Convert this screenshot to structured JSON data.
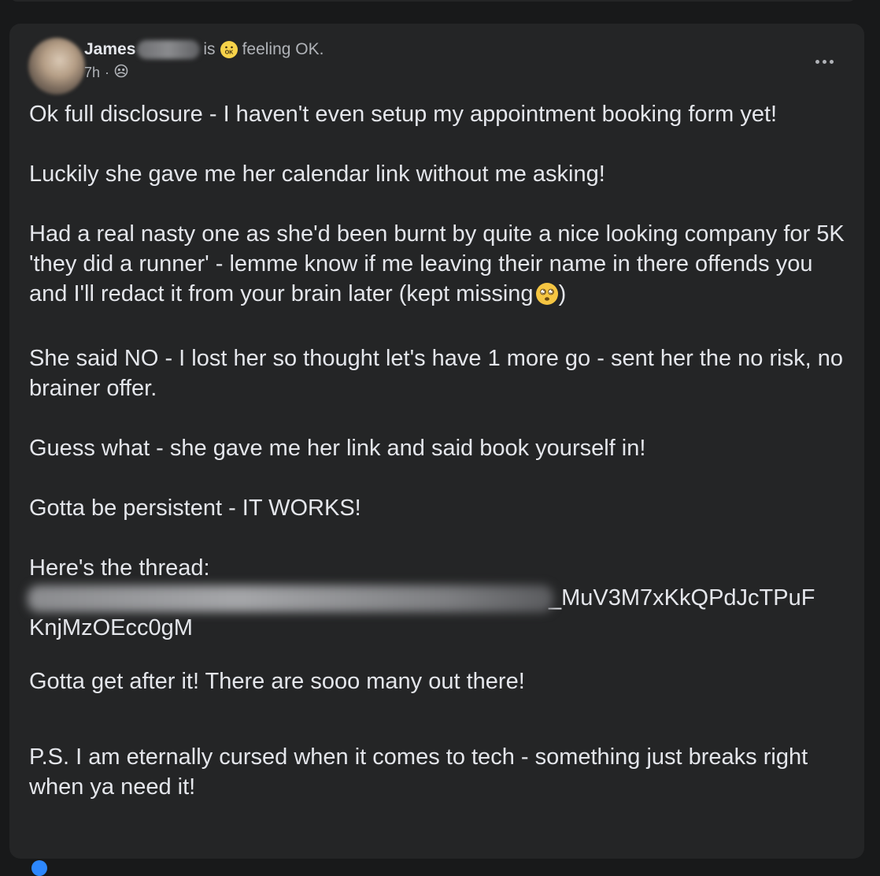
{
  "post": {
    "author_name": "James",
    "feeling_prefix": "is",
    "feeling_text": "feeling OK.",
    "timestamp": "7h",
    "meta_separator": "·",
    "paragraphs": {
      "p1": "Ok full disclosure - I haven't even setup my appointment booking form yet!",
      "p2": "Luckily she gave me her calendar link without me asking!",
      "p3": "Had a real nasty one as she'd been burnt by quite a nice looking company for 5K 'they did a runner' - lemme know if me leaving their name in there offends you and I'll redact it from your brain later (kept missing",
      "p3_end": ")",
      "p4": "She said NO - I lost her so thought let's have 1 more go - sent her the no risk, no brainer offer.",
      "p5": "Guess what - she gave me her link and said book yourself in!",
      "p6": "Gotta be persistent - IT WORKS!",
      "p7": "Here's the thread:",
      "url_visible_1": "_MuV3M7xKkQPdJcTPuF",
      "url_visible_2": "KnjMzOEcc0gM",
      "p8": "Gotta get after it! There are sooo many out there!",
      "p9": "P.S. I am eternally cursed when it comes to tech - something just breaks right when ya need it!"
    },
    "icons": {
      "feeling": "ok-face-emoji-icon",
      "privacy": "friends-audience-icon",
      "more": "more-options-icon",
      "inline_emoji": "dizzy-face-emoji-icon"
    },
    "colors": {
      "background": "#18191a",
      "card": "#242526",
      "primary_text": "#e4e6eb",
      "secondary_text": "#b0b3b8",
      "accent": "#2d88ff"
    }
  }
}
